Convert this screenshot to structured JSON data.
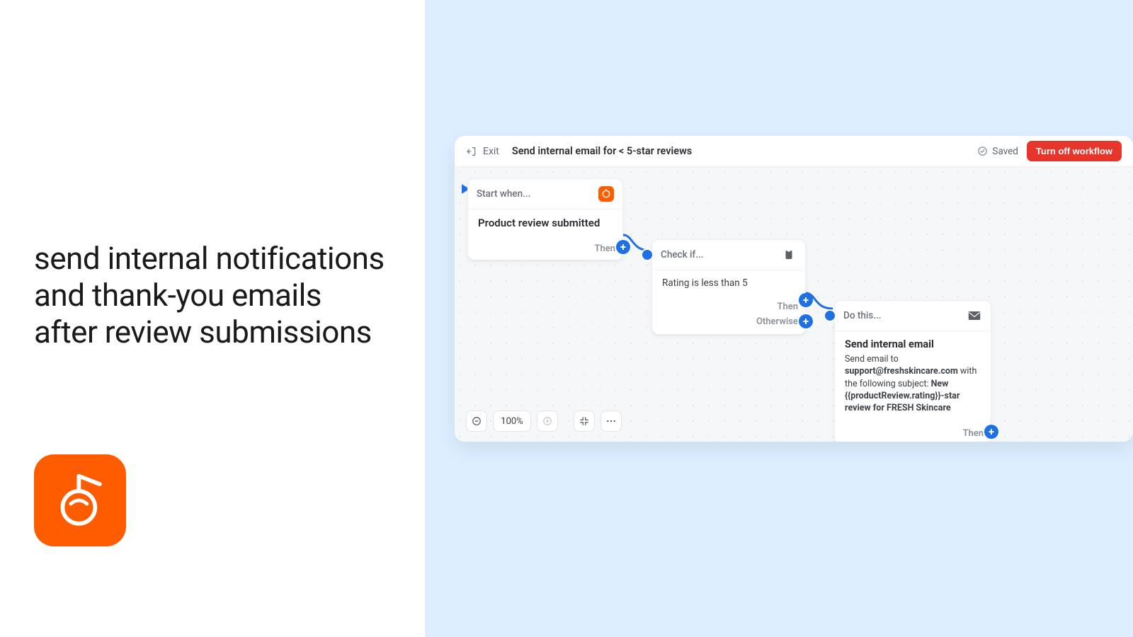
{
  "left": {
    "headline": "send internal notifications and thank-you emails after review submissions"
  },
  "header": {
    "exit_label": "Exit",
    "title": "Send internal email for < 5-star reviews",
    "saved_label": "Saved",
    "turnoff_label": "Turn off workflow"
  },
  "nodes": {
    "trigger": {
      "head": "Start when...",
      "body": "Product review submitted",
      "then_label": "Then"
    },
    "condition": {
      "head": "Check if...",
      "body": "Rating is less than 5",
      "then_label": "Then",
      "otherwise_label": "Otherwise"
    },
    "action": {
      "head": "Do this...",
      "title": "Send internal email",
      "desc_prefix": "Send email to ",
      "desc_email": "support@freshskincare.com",
      "desc_mid": " with the following subject: ",
      "desc_subject": "New {{productReview.rating}}-star review for FRESH Skincare",
      "then_label": "Then"
    }
  },
  "zoom": {
    "percent": "100%"
  }
}
